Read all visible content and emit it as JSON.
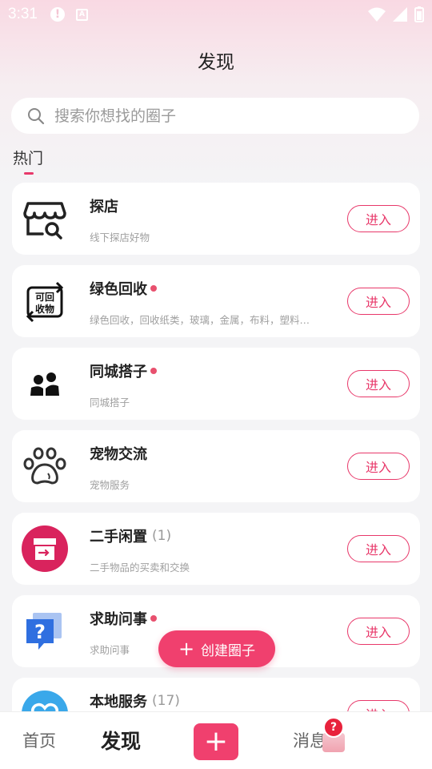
{
  "status": {
    "time": "3:31",
    "alert_icon": "alert-circle-icon",
    "a_icon": "a-box-icon",
    "a_label": "A"
  },
  "header": {
    "title": "发现"
  },
  "search": {
    "placeholder": "搜索你想找的圈子"
  },
  "section": {
    "label": "热门"
  },
  "cards": [
    {
      "name": "探店",
      "desc": "线下探店好物",
      "count": "",
      "dot": false,
      "button": "进入",
      "icon": "shop-search-icon"
    },
    {
      "name": "绿色回收",
      "desc": "绿色回收，回收纸类，玻璃，金属，布料，塑料…",
      "count": "",
      "dot": true,
      "button": "进入",
      "icon": "recycle-icon",
      "icon_text_1": "可回",
      "icon_text_2": "收物"
    },
    {
      "name": "同城搭子",
      "desc": "同城搭子",
      "count": "",
      "dot": true,
      "button": "进入",
      "icon": "people-icon"
    },
    {
      "name": "宠物交流",
      "desc": "宠物服务",
      "count": "",
      "dot": false,
      "button": "进入",
      "icon": "paw-icon"
    },
    {
      "name": "二手闲置",
      "desc": "二手物品的买卖和交换",
      "count": "(1)",
      "dot": false,
      "button": "进入",
      "icon": "secondhand-box-icon"
    },
    {
      "name": "求助问事",
      "desc": "求助问事",
      "count": "",
      "dot": true,
      "button": "进入",
      "icon": "question-bubble-icon"
    },
    {
      "name": "本地服务",
      "desc": "",
      "count": "(17)",
      "dot": false,
      "button": "进入",
      "icon": "heart-circle-icon"
    }
  ],
  "fab": {
    "label": "创建圈子"
  },
  "nav": {
    "home": "首页",
    "discover": "发现",
    "message": "消息",
    "message_badge": "?"
  },
  "colors": {
    "accent": "#f0406e",
    "dot": "#e8506e",
    "text": "#222222",
    "sub": "#a0a0a0"
  }
}
